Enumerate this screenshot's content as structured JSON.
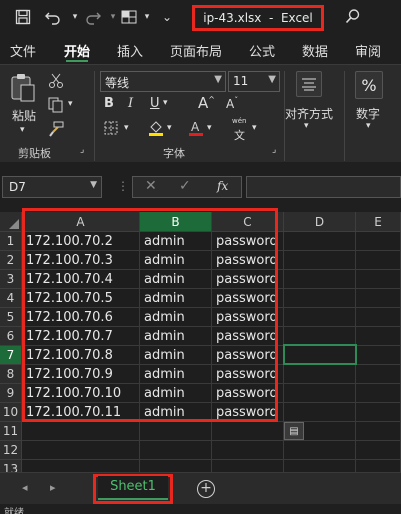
{
  "window": {
    "title": "ip-43.xlsx  -  Excel"
  },
  "ribbon_tabs": [
    "文件",
    "开始",
    "插入",
    "页面布局",
    "公式",
    "数据",
    "审阅"
  ],
  "active_tab": "开始",
  "ribbon": {
    "paste_label": "粘贴",
    "clipboard_group": "剪贴板",
    "font_name": "等线",
    "font_size": "11",
    "bold": "B",
    "italic": "I",
    "underline": "U",
    "grow_font": "A",
    "shrink_font": "A",
    "font_group": "字体",
    "align_label": "对齐方式",
    "number_label": "数字",
    "number_symbol": "%",
    "wen_label": "wén"
  },
  "formula_bar": {
    "name_box": "D7",
    "fx": "fx",
    "formula": ""
  },
  "columns": [
    "A",
    "B",
    "C",
    "D",
    "E"
  ],
  "selected_column": "B",
  "rows": [
    {
      "num": "1",
      "a": "172.100.70.2",
      "b": "admin",
      "c": "password"
    },
    {
      "num": "2",
      "a": "172.100.70.3",
      "b": "admin",
      "c": "password"
    },
    {
      "num": "3",
      "a": "172.100.70.4",
      "b": "admin",
      "c": "password"
    },
    {
      "num": "4",
      "a": "172.100.70.5",
      "b": "admin",
      "c": "password"
    },
    {
      "num": "5",
      "a": "172.100.70.6",
      "b": "admin",
      "c": "password"
    },
    {
      "num": "6",
      "a": "172.100.70.7",
      "b": "admin",
      "c": "password"
    },
    {
      "num": "7",
      "a": "172.100.70.8",
      "b": "admin",
      "c": "password"
    },
    {
      "num": "8",
      "a": "172.100.70.9",
      "b": "admin",
      "c": "password"
    },
    {
      "num": "9",
      "a": "172.100.70.10",
      "b": "admin",
      "c": "password"
    },
    {
      "num": "10",
      "a": "172.100.70.11",
      "b": "admin",
      "c": "password"
    },
    {
      "num": "11",
      "a": "",
      "b": "",
      "c": ""
    },
    {
      "num": "12",
      "a": "",
      "b": "",
      "c": ""
    },
    {
      "num": "13",
      "a": "",
      "b": "",
      "c": ""
    }
  ],
  "active_cell": "D7",
  "sheets": [
    "Sheet1"
  ],
  "add_sheet": "+",
  "status": "就绪",
  "colors": {
    "accent": "#3f9b5c",
    "highlight": "#e8281f",
    "background": "#1e1e1e"
  }
}
